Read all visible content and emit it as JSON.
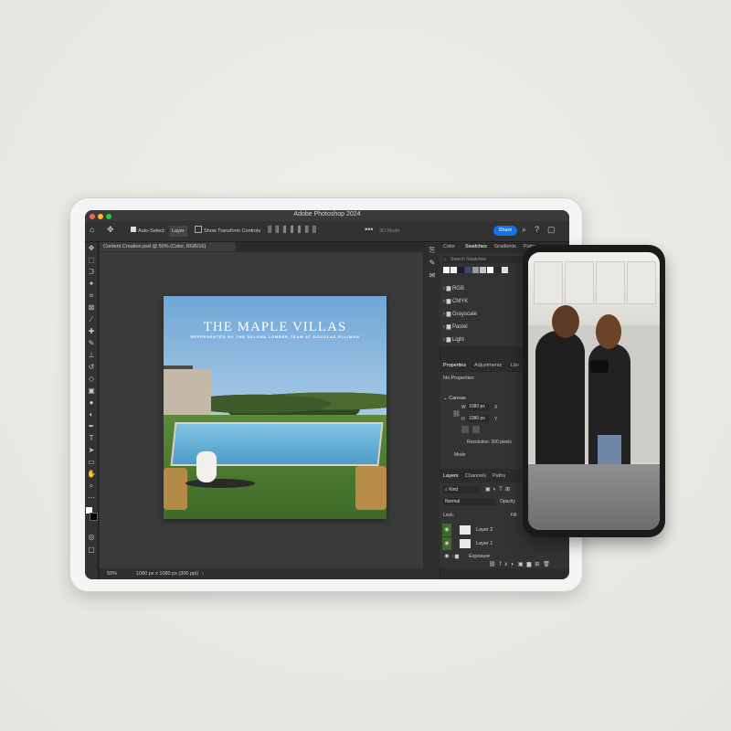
{
  "app": {
    "title": "Adobe Photoshop 2024",
    "share_label": "Share"
  },
  "options_bar": {
    "auto_select_label": "Auto-Select:",
    "auto_select_value": "Layer",
    "transform_label": "Show Transform Controls",
    "mode_3d": "3D Mode"
  },
  "document": {
    "tab_label": "Content Creation.psd @ 50% (Color, RGB/16)",
    "zoom": "50%",
    "dimensions": "1080 px x 1080 px (300 ppi)"
  },
  "artwork": {
    "title": "THE MAPLE VILLAS",
    "subtitle": "REPRESENTED BY THE DELUNA LOMBER TEAM AT DOUGLAS ELLIMAN"
  },
  "panels": {
    "top_tabs": [
      "Color",
      "Swatches",
      "Gradients",
      "Patte"
    ],
    "search_placeholder": "Search Swatches",
    "swatch_colors": [
      "#ffffff",
      "#f2f2f2",
      "#1c1c3c",
      "#3b4a6b",
      "#9a9a9a",
      "#c8c8c8",
      "#ffffff",
      "#2a2a2a",
      "#e0e0e0"
    ],
    "swatch_folders": [
      "RGB",
      "CMYK",
      "Grayscale",
      "Pastel",
      "Light"
    ],
    "mid_tabs": [
      "Properties",
      "Adjustments",
      "Libr"
    ],
    "no_properties": "No Properties",
    "canvas_label": "Canvas",
    "width_label": "W",
    "width_value": "1080 px",
    "height_label": "H",
    "height_value": "1080 px",
    "x_label": "X",
    "y_label": "Y",
    "resolution": "Resolution: 300 pixels",
    "mode_label": "Mode",
    "layer_tabs": [
      "Layers",
      "Channels",
      "Paths"
    ],
    "kind_label": "Kind",
    "blend_mode": "Normal",
    "opacity_label": "Opacity",
    "lock_label": "Lock:",
    "fill_label": "Fill:",
    "layers": [
      "Layer 2",
      "Layer 1",
      "Exposure"
    ]
  },
  "colors": {
    "accent": "#1473e6",
    "panel_bg": "#333333",
    "canvas_bg": "#3a3a3a"
  }
}
